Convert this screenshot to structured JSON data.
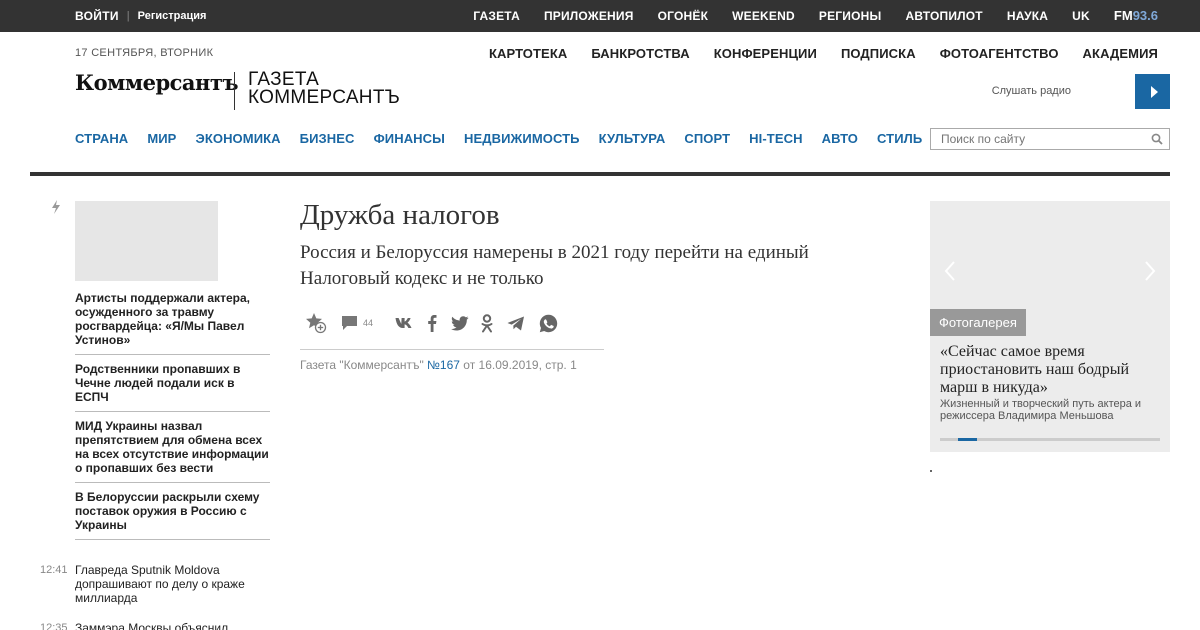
{
  "topbar": {
    "login": "ВОЙТИ",
    "separator": "|",
    "register": "Регистрация",
    "nav": [
      "ГАЗЕТА",
      "ПРИЛОЖЕНИЯ",
      "ОГОНЁК",
      "WEEKEND",
      "РЕГИОНЫ",
      "АВТОПИЛОТ",
      "НАУКА",
      "UK"
    ],
    "fm_prefix": "FM",
    "fm_freq": "93.6"
  },
  "header": {
    "date": "17 СЕНТЯБРЯ, ВТОРНИК",
    "section_nav": [
      "КАРТОТЕКА",
      "БАНКРОТСТВА",
      "КОНФЕРЕНЦИИ",
      "ПОДПИСКА",
      "ФОТОАГЕНТСТВО",
      "АКАДЕМИЯ"
    ],
    "logo_main": "Коммерсантъ",
    "logo_sub_line1": "ГАЗЕТА",
    "logo_sub_line2": "КОММЕРСАНТЪ",
    "radio_label": "Слушать радио",
    "rubrics": [
      "СТРАНА",
      "МИР",
      "ЭКОНОМИКА",
      "БИЗНЕС",
      "ФИНАНСЫ",
      "НЕДВИЖИМОСТЬ",
      "КУЛЬТУРА",
      "СПОРТ",
      "HI-TECH",
      "АВТО",
      "СТИЛЬ"
    ],
    "search_placeholder": "Поиск по сайту"
  },
  "news": {
    "items": [
      "Артисты поддержали актера, осужденного за травму росгвардейца: «Я/Мы Павел Устинов»",
      "Родственники пропавших в Чечне людей подали иск в ЕСПЧ",
      "МИД Украины назвал препятствием для обмена всех на всех отсутствие информации о пропавших без вести",
      "В Белоруссии раскрыли схему поставок оружия в Россию с Украины"
    ],
    "timed": [
      {
        "time": "12:41",
        "text": "Главреда Sputnik Moldova допрашивают по делу о краже миллиарда"
      },
      {
        "time": "12:35",
        "text": "Заммэра Москвы объяснил"
      }
    ]
  },
  "article": {
    "title": "Дружба налогов",
    "subtitle": "Россия и Белоруссия намерены в 2021 году перейти на единый Налоговый кодекс и не только",
    "comments_count": "44",
    "source_prefix": "Газета \"Коммерсантъ\"",
    "issue": "№167",
    "source_suffix": "от 16.09.2019, стр. 1"
  },
  "gallery": {
    "badge": "Фотогалерея",
    "title": "«Сейчас самое время приостановить наш бодрый марш в никуда»",
    "description": "Жизненный и творческий путь актера и режиссера Владимира Меньшова",
    "progress": 0.17
  },
  "colors": {
    "accent": "#1a67a3",
    "topbar": "#333333",
    "gallery_bg": "#ececec"
  }
}
